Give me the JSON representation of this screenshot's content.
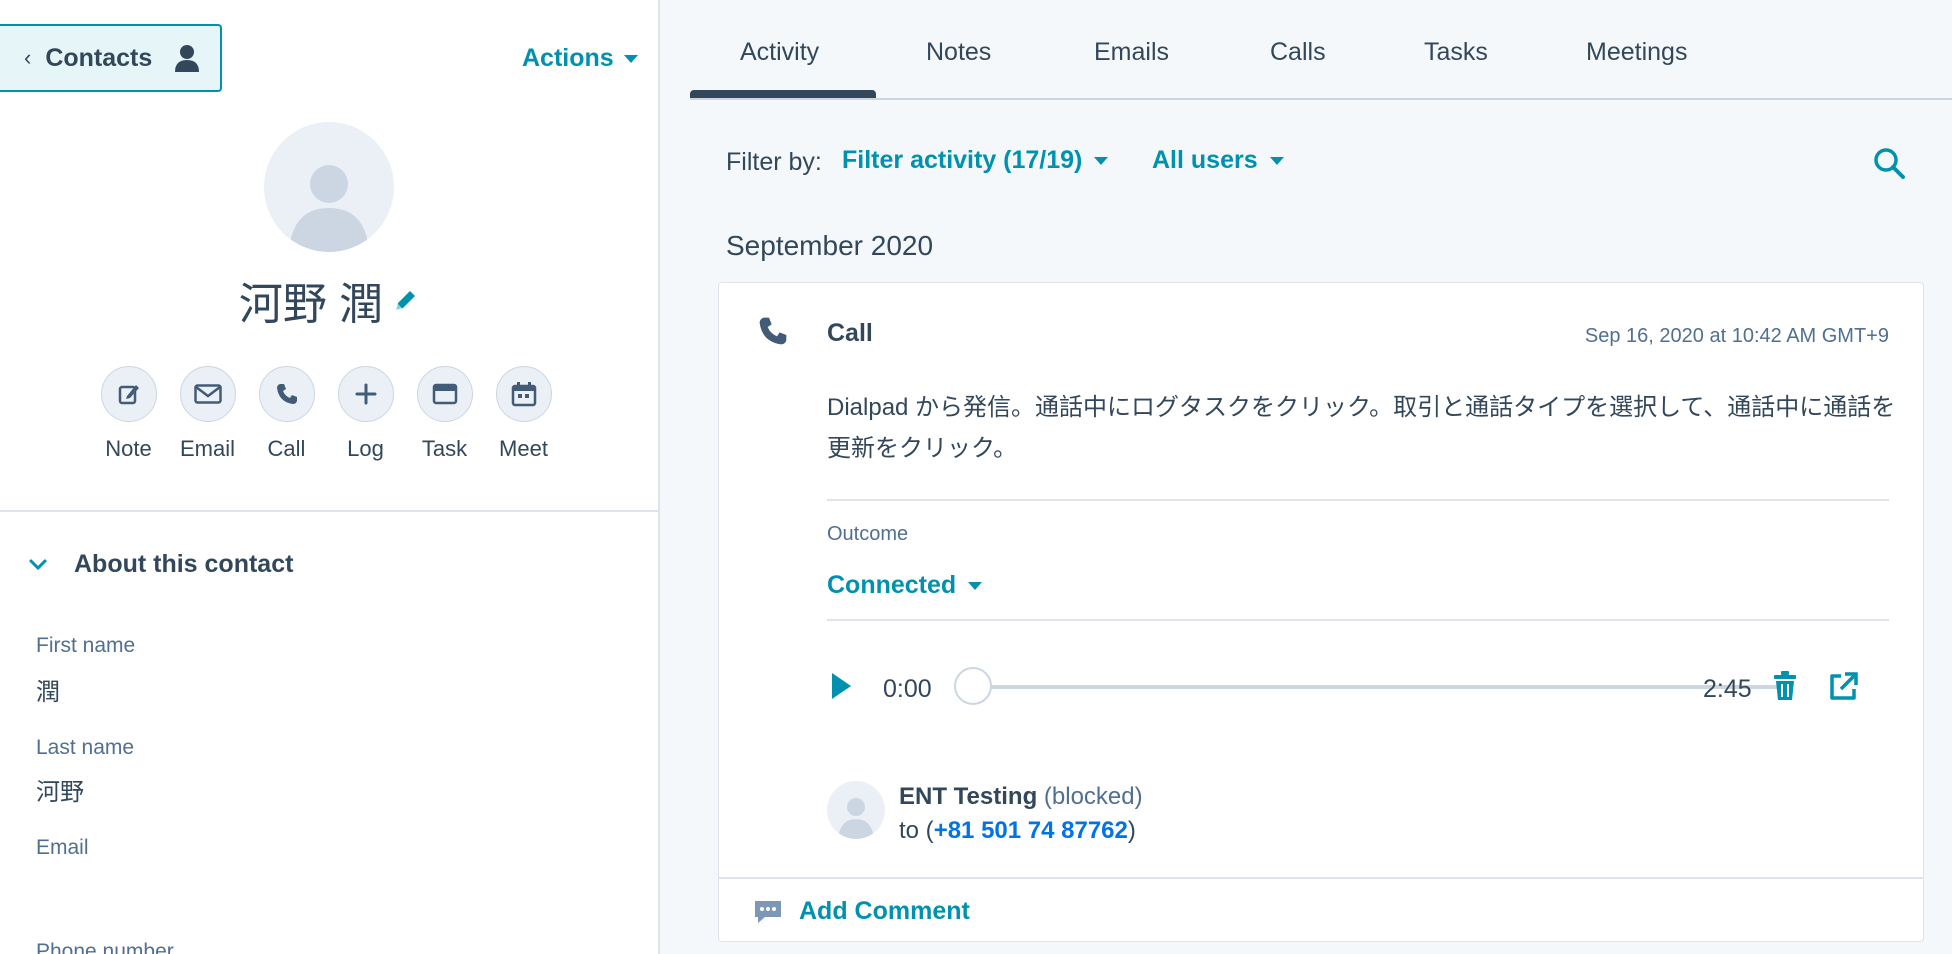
{
  "sidebar": {
    "contacts_label": "Contacts",
    "actions_label": "Actions",
    "contact_name": "河野 潤",
    "quick_actions": [
      {
        "label": "Note",
        "icon": "note-icon"
      },
      {
        "label": "Email",
        "icon": "email-icon"
      },
      {
        "label": "Call",
        "icon": "call-icon"
      },
      {
        "label": "Log",
        "icon": "plus-icon"
      },
      {
        "label": "Task",
        "icon": "task-icon"
      },
      {
        "label": "Meet",
        "icon": "calendar-icon"
      }
    ],
    "about_title": "About this contact",
    "fields": [
      {
        "label": "First name",
        "value": "潤"
      },
      {
        "label": "Last name",
        "value": "河野"
      },
      {
        "label": "Email",
        "value": ""
      },
      {
        "label": "Phone number",
        "value": ""
      }
    ]
  },
  "tabs": [
    {
      "label": "Activity",
      "active": true
    },
    {
      "label": "Notes"
    },
    {
      "label": "Emails"
    },
    {
      "label": "Calls"
    },
    {
      "label": "Tasks"
    },
    {
      "label": "Meetings"
    }
  ],
  "filter": {
    "label": "Filter by:",
    "activity": "Filter activity (17/19)",
    "users": "All users"
  },
  "timeline": {
    "month": "September 2020",
    "call_card": {
      "type": "Call",
      "timestamp": "Sep 16, 2020 at 10:42 AM GMT+9",
      "body": "Dialpad から発信。通話中にログタスクをクリック。取引と通話タイプを選択して、通話中に通話を更新をクリック。",
      "outcome_label": "Outcome",
      "outcome_value": "Connected",
      "player": {
        "current": "0:00",
        "duration": "2:45",
        "progress": 0
      },
      "caller": {
        "name": "ENT Testing",
        "status": "(blocked)",
        "to_prefix": "to (",
        "phone": "+81 501 74 87762",
        "to_suffix": ")"
      },
      "add_comment": "Add Comment"
    }
  },
  "colors": {
    "accent": "#0091ae",
    "text": "#33475b",
    "muted": "#516f90",
    "link": "#0073e6",
    "border": "#dfe3eb"
  }
}
